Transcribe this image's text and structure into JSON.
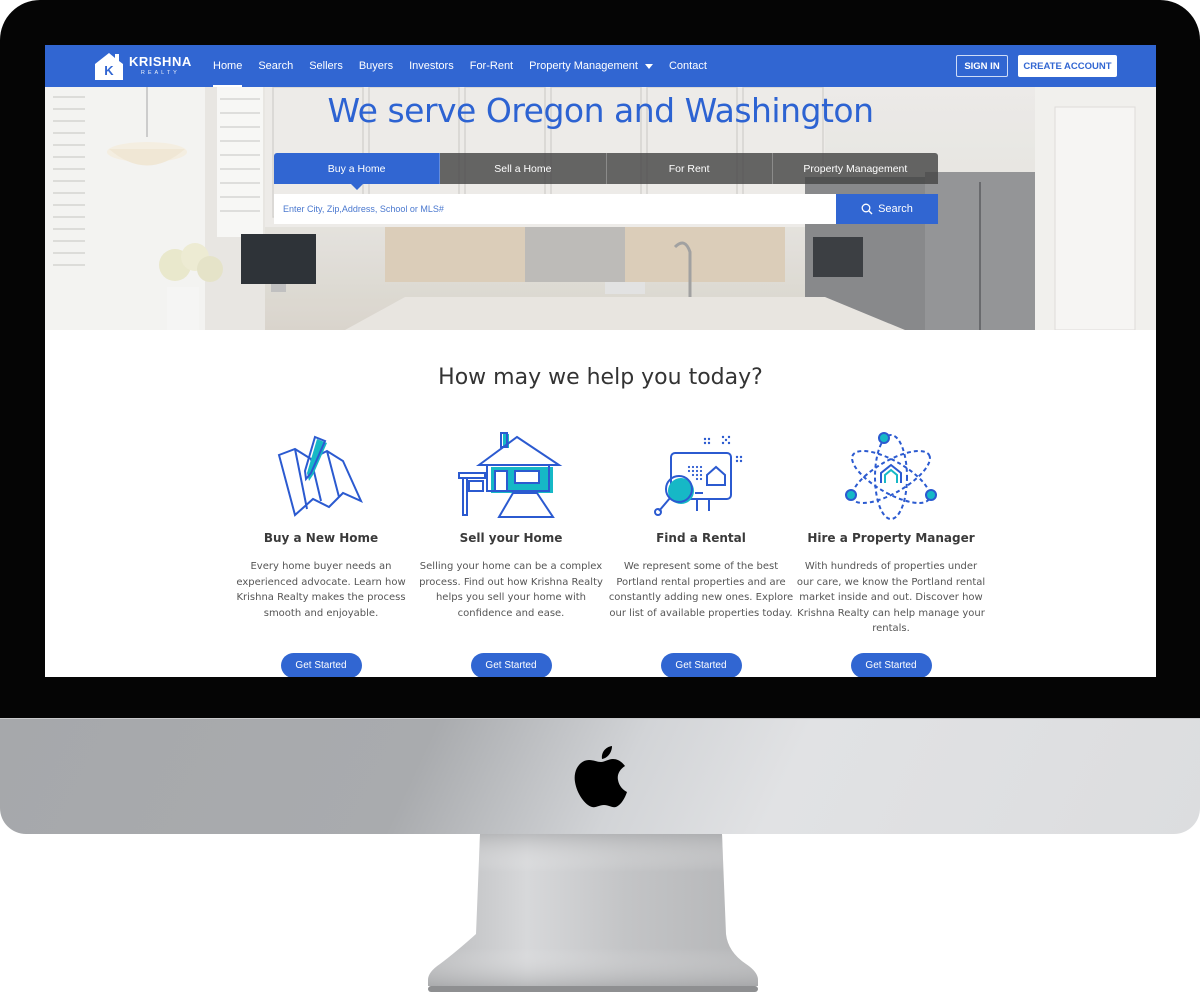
{
  "brand": {
    "name": "KRISHNA",
    "subtitle": "REALTY",
    "logo_letter": "K",
    "primary_color": "#3166d2",
    "accent_color": "#16b8c6"
  },
  "nav": {
    "links": [
      {
        "label": "Home",
        "active": true
      },
      {
        "label": "Search"
      },
      {
        "label": "Sellers"
      },
      {
        "label": "Buyers"
      },
      {
        "label": "Investors"
      },
      {
        "label": "For-Rent"
      },
      {
        "label": "Property Management",
        "has_dropdown": true
      },
      {
        "label": "Contact"
      }
    ],
    "sign_in": "SIGN IN",
    "create_account": "CREATE ACCOUNT"
  },
  "hero": {
    "title": "We serve Oregon and Washington",
    "tabs": [
      {
        "label": "Buy a Home",
        "active": true
      },
      {
        "label": "Sell a Home"
      },
      {
        "label": "For Rent"
      },
      {
        "label": "Property Management"
      }
    ],
    "search": {
      "placeholder": "Enter City, Zip,Address, School or MLS#",
      "value": "",
      "button_label": "Search",
      "button_icon": "search-icon"
    }
  },
  "help": {
    "title": "How may we help you today?",
    "services": [
      {
        "icon": "map-pencil-icon",
        "title": "Buy a New Home",
        "description": "Every home buyer needs an experienced advocate. Learn how Krishna Realty makes the process smooth and enjoyable.",
        "button": "Get Started"
      },
      {
        "icon": "house-for-sale-icon",
        "title": "Sell your Home",
        "description": "Selling your home can be a complex process. Find out how Krishna Realty helps you sell your home with confidence and ease.",
        "button": "Get Started"
      },
      {
        "icon": "rental-search-icon",
        "title": "Find a Rental",
        "description": "We represent some of the best Portland rental properties and are constantly adding new ones. Explore our list of available properties today.",
        "button": "Get Started"
      },
      {
        "icon": "property-manager-atom-icon",
        "title": "Hire a Property Manager",
        "description": "With hundreds of properties under our care, we know the Portland rental market inside and out. Discover how Krishna Realty can help manage your rentals.",
        "button": "Get Started"
      }
    ]
  },
  "device": {
    "frame": "iMac",
    "logo_icon": "apple-logo-icon"
  }
}
